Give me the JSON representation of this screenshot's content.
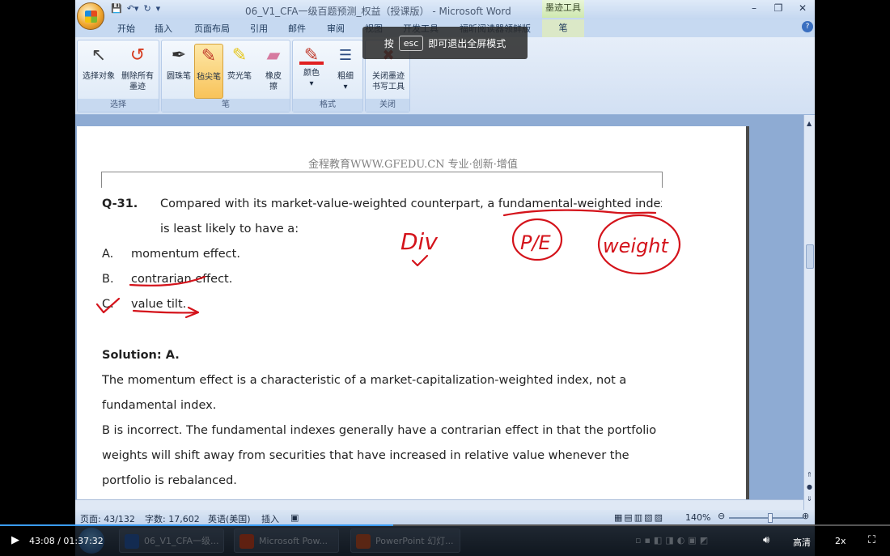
{
  "window": {
    "title": "06_V1_CFA一级百题预测_权益（授课版） - Microsoft Word",
    "context_tab_group": "墨迹工具",
    "controls": [
      "–",
      "❐",
      "✕"
    ]
  },
  "tabs": [
    "开始",
    "插入",
    "页面布局",
    "引用",
    "邮件",
    "审阅",
    "视图",
    "开发工具",
    "福昕阅读器领鲜版",
    "笔"
  ],
  "ribbon": {
    "groups": [
      {
        "label": "选择",
        "buttons": [
          "选择对象",
          "删除所有墨迹"
        ]
      },
      {
        "label": "笔",
        "buttons": [
          "圆珠笔",
          "毡尖笔",
          "荧光笔",
          "橡皮擦"
        ]
      },
      {
        "label": "格式",
        "buttons": [
          "颜色",
          "粗细"
        ]
      },
      {
        "label": "关闭",
        "buttons": [
          "关闭墨迹书写工具"
        ]
      }
    ],
    "selected_pen": "毡尖笔"
  },
  "fullscreen_tip": {
    "pre": "按",
    "key": "esc",
    "post": "即可退出全屏模式"
  },
  "document": {
    "header": "金程教育WWW.GFEDU.CN 专业·创新·增值",
    "question_no": "Q-31.",
    "question_line1": "Compared with its market-value-weighted counterpart, a fundamental-weighted index",
    "question_line2": "is least likely to have a:",
    "options": [
      {
        "letter": "A.",
        "text": "momentum effect."
      },
      {
        "letter": "B.",
        "text": "contrarian effect."
      },
      {
        "letter": "C.",
        "text": "value tilt."
      }
    ],
    "solution_label": "Solution: A.",
    "solution_lines": [
      "The momentum effect is a characteristic of a market-capitalization-weighted index, not a",
      "fundamental index.",
      "B is incorrect. The fundamental indexes generally have a contrarian effect in that the portfolio",
      "weights will shift away from securities that have increased in relative value whenever the",
      "portfolio is rebalanced."
    ],
    "ink_annotations": [
      "Div",
      "P/E",
      "weight"
    ],
    "ink_color": "#d4131b"
  },
  "status": {
    "page": "页面: 43/132",
    "words": "字数: 17,602",
    "language": "英语(美国)",
    "mode": "插入",
    "zoom": "140%"
  },
  "taskbar": {
    "tasks": [
      "06_V1_CFA一级...",
      "Microsoft Pow...",
      "PowerPoint 幻灯..."
    ]
  },
  "player": {
    "time": "43:08 / 01:37:32",
    "quality": "高清",
    "speed": "2x",
    "progress": 0.442
  }
}
